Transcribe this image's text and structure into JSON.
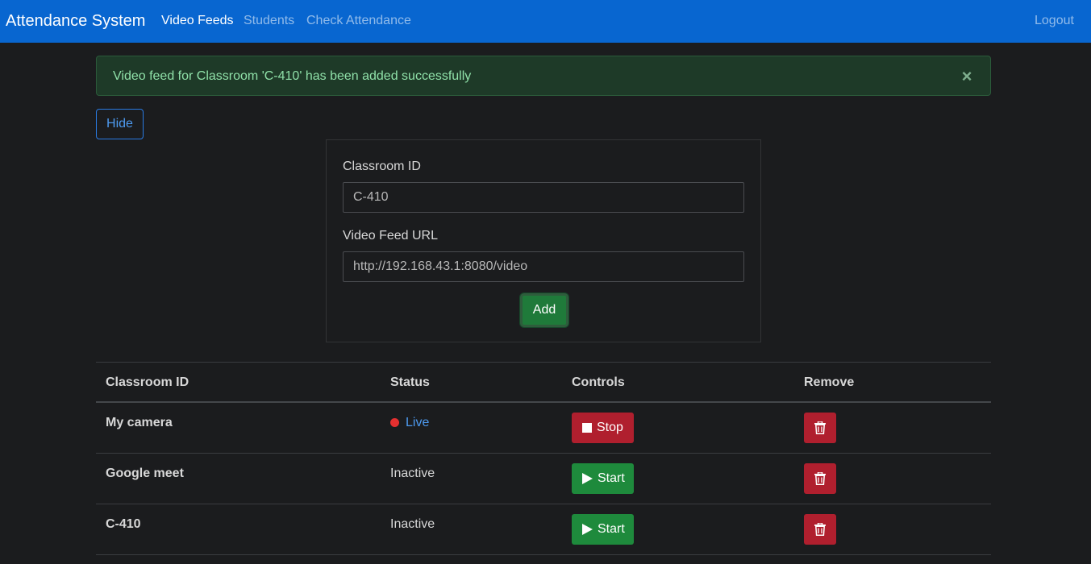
{
  "navbar": {
    "brand": "Attendance System",
    "links": [
      {
        "label": "Video Feeds",
        "active": true
      },
      {
        "label": "Students",
        "active": false
      },
      {
        "label": "Check Attendance",
        "active": false
      }
    ],
    "logout": "Logout"
  },
  "alert": {
    "message": "Video feed for Classroom 'C-410' has been added successfully",
    "close_icon": "×"
  },
  "hide_button": "Hide",
  "form": {
    "classroom_label": "Classroom ID",
    "classroom_value": "C-410",
    "url_label": "Video Feed URL",
    "url_value": "http://192.168.43.1:8080/video",
    "add_button": "Add"
  },
  "table": {
    "headers": [
      "Classroom ID",
      "Status",
      "Controls",
      "Remove"
    ],
    "rows": [
      {
        "classroom": "My camera",
        "status": "Live",
        "control": "Stop"
      },
      {
        "classroom": "Google meet",
        "status": "Inactive",
        "control": "Start"
      },
      {
        "classroom": "C-410",
        "status": "Inactive",
        "control": "Start"
      }
    ]
  },
  "colors": {
    "navbar": "#0866d0",
    "background": "#1b1c1e",
    "live_dot": "#e53030",
    "stop": "#b01f2e",
    "start": "#1e8a3c"
  },
  "icons": {
    "stop": "stop-square-icon",
    "start": "play-icon",
    "remove": "trash-icon",
    "close": "close-icon",
    "live": "live-dot-icon"
  }
}
